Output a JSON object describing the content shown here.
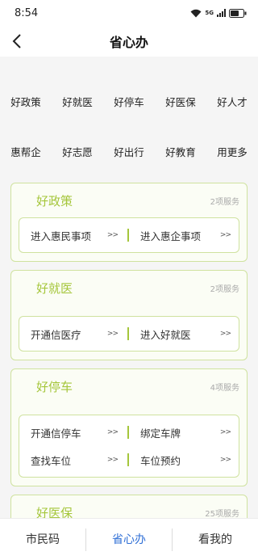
{
  "status": {
    "time": "8:54",
    "signal_label": "5G",
    "icons": [
      "wifi-icon",
      "signal-icon",
      "battery-icon"
    ]
  },
  "nav": {
    "title": "省心办",
    "back_icon": "chevron-left-icon"
  },
  "grid": [
    "好政策",
    "好就医",
    "好停车",
    "好医保",
    "好人才",
    "惠帮企",
    "好志愿",
    "好出行",
    "好教育",
    "用更多"
  ],
  "cards": [
    {
      "title": "好政策",
      "count": "2项服务",
      "items": [
        {
          "label": "进入惠民事项",
          "arrow": ">>"
        },
        {
          "label": "进入惠企事项",
          "arrow": ">>"
        }
      ]
    },
    {
      "title": "好就医",
      "count": "2项服务",
      "items": [
        {
          "label": "开通信医疗",
          "arrow": ">>"
        },
        {
          "label": "进入好就医",
          "arrow": ">>"
        }
      ]
    },
    {
      "title": "好停车",
      "count": "4项服务",
      "items": [
        {
          "label": "开通信停车",
          "arrow": ">>"
        },
        {
          "label": "绑定车牌",
          "arrow": ">>"
        },
        {
          "label": "查找车位",
          "arrow": ">>"
        },
        {
          "label": "车位预约",
          "arrow": ">>"
        }
      ]
    },
    {
      "title": "好医保",
      "count": "25项服务",
      "items": []
    }
  ],
  "tabs": [
    {
      "label": "市民码",
      "active": false
    },
    {
      "label": "省心办",
      "active": true
    },
    {
      "label": "看我的",
      "active": false
    }
  ],
  "colors": {
    "accent": "#a5c63b",
    "tab_active": "#2f6fd6",
    "card_border": "#cfe29f"
  }
}
